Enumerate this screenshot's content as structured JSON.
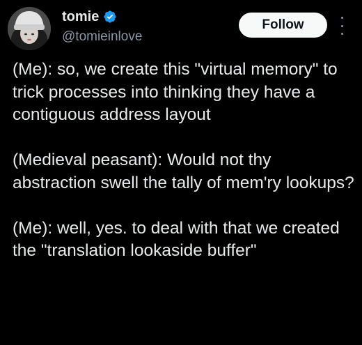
{
  "user": {
    "display_name": "tomie",
    "handle": "@tomieinlove",
    "verified": true
  },
  "actions": {
    "follow_label": "Follow"
  },
  "icons": {
    "verified": "verified-badge-icon",
    "more": "more-options-icon"
  },
  "colors": {
    "background": "#000000",
    "text": "#e7e9ea",
    "muted": "#8b98a5",
    "verified": "#1d9bf0",
    "follow_bg": "#f7f9f9"
  },
  "tweet": {
    "paragraphs": [
      "(Me): so, we create this \"virtual memory\" to trick processes into thinking they have a contiguous address layout",
      "(Medieval peasant): Would not thy abstraction swell the tally of mem'ry lookups?",
      "(Me): well, yes. to deal with that we created the \"translation lookaside buffer\""
    ]
  }
}
